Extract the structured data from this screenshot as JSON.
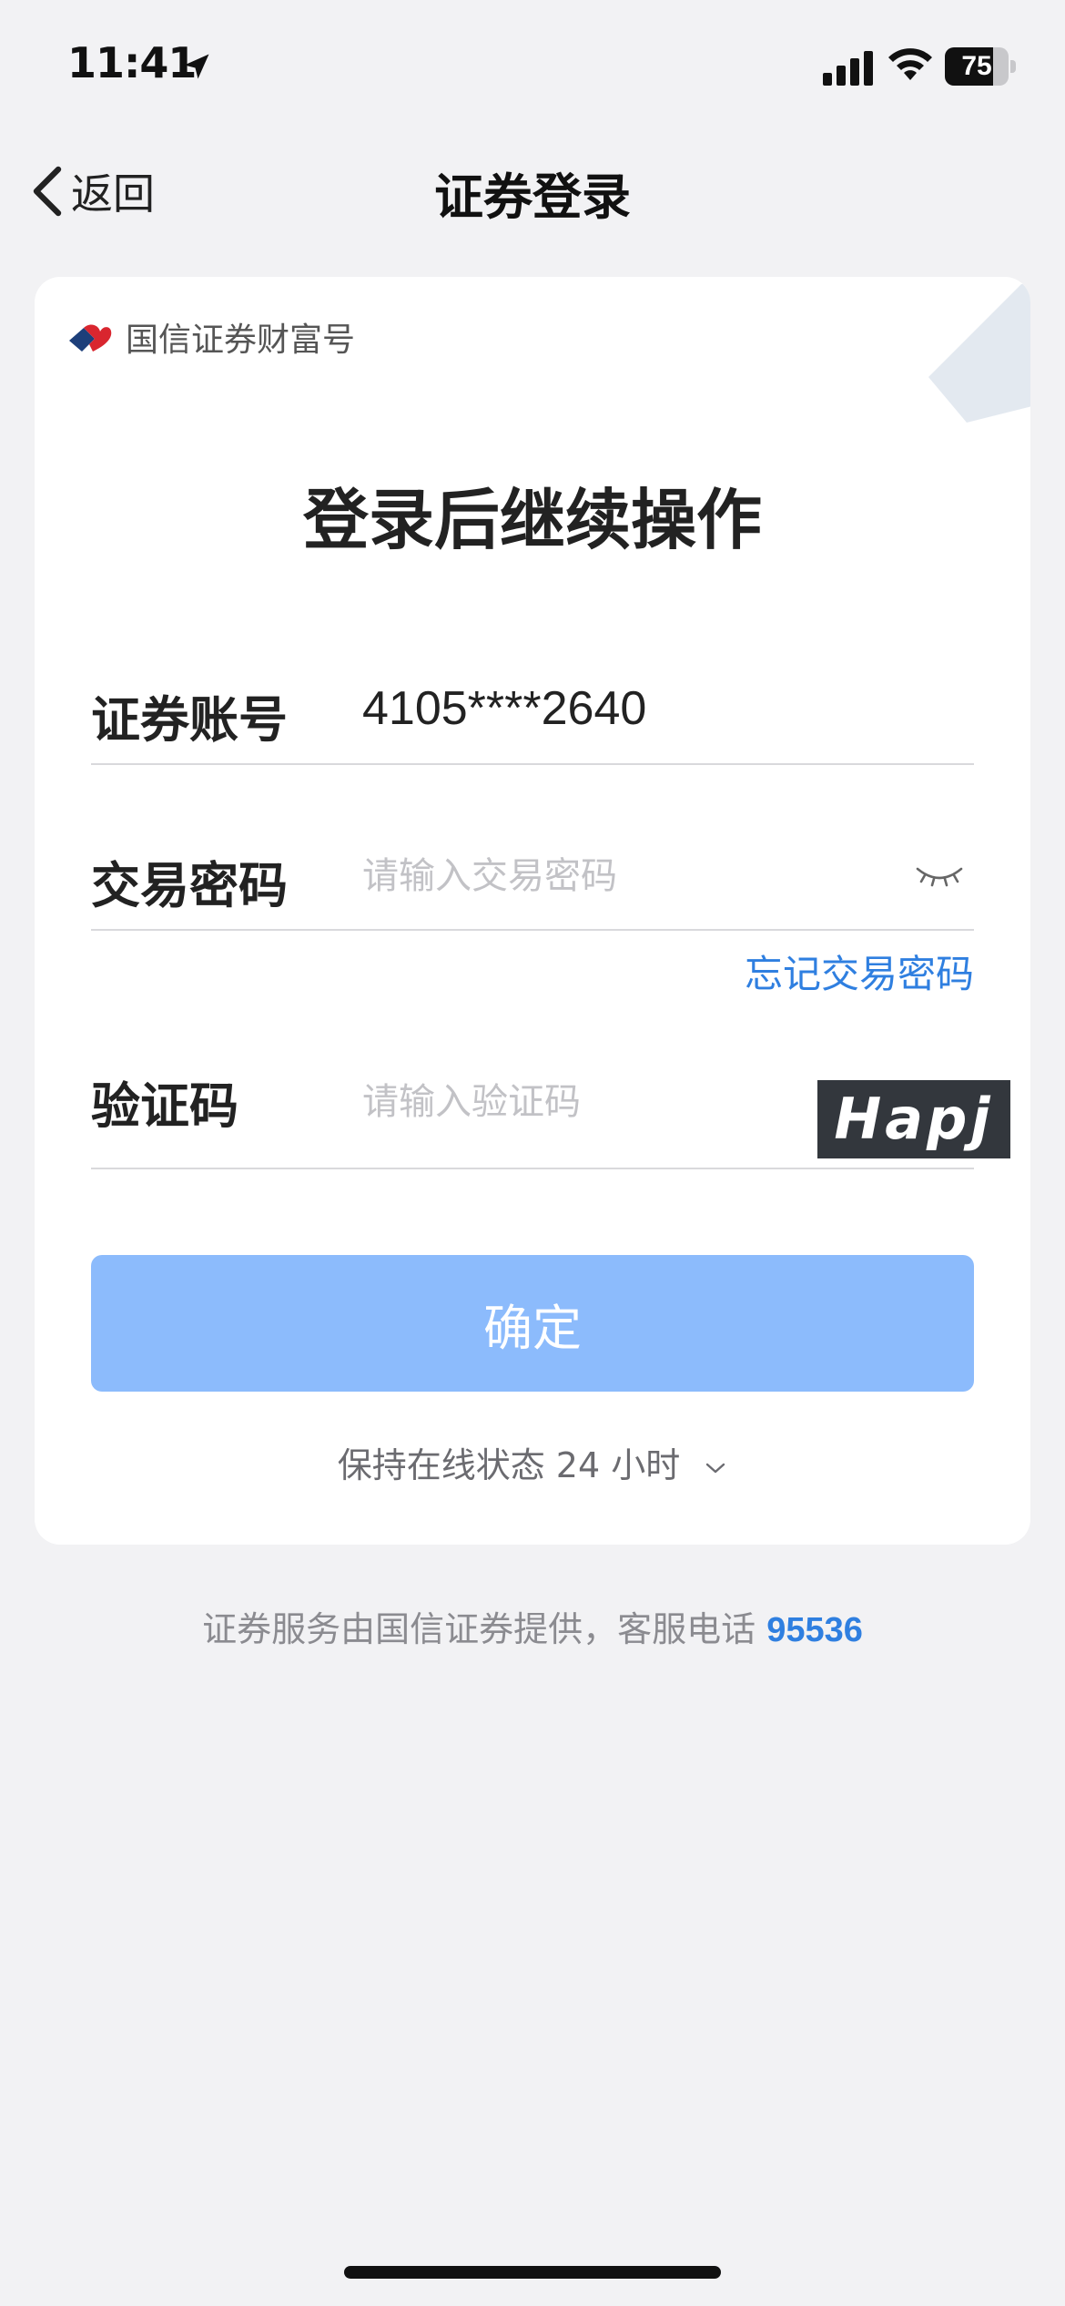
{
  "status_bar": {
    "time": "11:41",
    "battery_level": "75",
    "battery_fraction": 0.75
  },
  "nav": {
    "back_label": "返回",
    "title": "证券登录"
  },
  "card": {
    "brand_name": "国信证券财富号",
    "heading": "登录后继续操作",
    "account": {
      "label": "证券账号",
      "value": "4105****2640"
    },
    "password": {
      "label": "交易密码",
      "placeholder": "请输入交易密码"
    },
    "forgot_password": "忘记交易密码",
    "captcha": {
      "label": "验证码",
      "placeholder": "请输入验证码",
      "image_text": "Hapj"
    },
    "confirm_label": "确定",
    "keep_online_label": "保持在线状态 24 小时"
  },
  "footer": {
    "text": "证券服务由国信证券提供，客服电话",
    "phone": "95536"
  },
  "colors": {
    "accent": "#2f7fe0",
    "button_disabled": "#8cbbfc",
    "background": "#f2f2f4"
  }
}
